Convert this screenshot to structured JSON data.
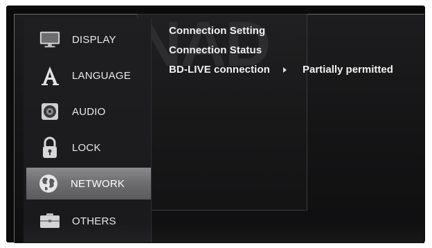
{
  "watermark": "NAD",
  "sidebar": {
    "items": [
      {
        "label": "DISPLAY",
        "icon": "display-icon",
        "selected": false
      },
      {
        "label": "LANGUAGE",
        "icon": "language-icon",
        "selected": false
      },
      {
        "label": "AUDIO",
        "icon": "audio-icon",
        "selected": false
      },
      {
        "label": "LOCK",
        "icon": "lock-icon",
        "selected": false
      },
      {
        "label": "NETWORK",
        "icon": "network-icon",
        "selected": true
      },
      {
        "label": "OTHERS",
        "icon": "others-icon",
        "selected": false
      }
    ]
  },
  "submenu": {
    "items": [
      {
        "label": "Connection Setting"
      },
      {
        "label": "Connection Status"
      },
      {
        "label": "BD-LIVE connection",
        "value": "Partially permitted"
      }
    ]
  },
  "colors": {
    "background": "#141415",
    "highlight": "#7a7a7c",
    "text": "#f2f2f2"
  }
}
